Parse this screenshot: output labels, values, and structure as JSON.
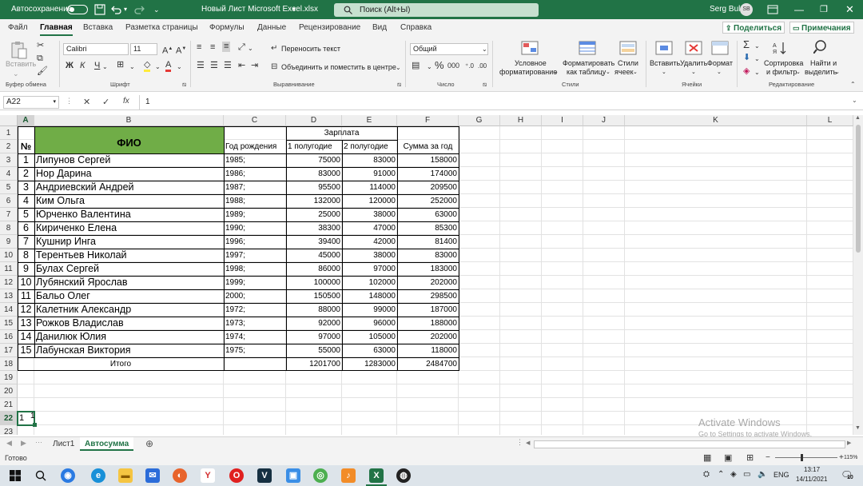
{
  "titlebar": {
    "autosave_label": "Автосохранение",
    "autosave_state": "off",
    "file_name": "Новый Лист Microsoft Excel.xlsx",
    "search_placeholder": "Поиск (Alt+Ы)",
    "user_name": "Serg Bul",
    "user_initials": "SB"
  },
  "menu": {
    "tabs": [
      "Файл",
      "Главная",
      "Вставка",
      "Разметка страницы",
      "Формулы",
      "Данные",
      "Рецензирование",
      "Вид",
      "Справка"
    ],
    "active_tab": "Главная",
    "share_label": "Поделиться",
    "comments_label": "Примечания"
  },
  "ribbon": {
    "paste_label": "Вставить",
    "clipboard_group": "Буфер обмена",
    "font_name": "Calibri",
    "font_size": "11",
    "bold": "Ж",
    "italic": "К",
    "underline": "Ч",
    "font_group": "Шрифт",
    "wrap_text": "Переносить текст",
    "merge_center": "Объединить и поместить в центре",
    "alignment_group": "Выравнивание",
    "number_format": "Общий",
    "number_group": "Число",
    "cond_format_1": "Условное",
    "cond_format_2": "форматирование",
    "format_table_1": "Форматировать",
    "format_table_2": "как таблицу",
    "cell_styles_1": "Стили",
    "cell_styles_2": "ячеек",
    "styles_group": "Стили",
    "insert_label": "Вставить",
    "delete_label": "Удалить",
    "format_label": "Формат",
    "cells_group": "Ячейки",
    "sort_1": "Сортировка",
    "sort_2": "и фильтр",
    "find_1": "Найти и",
    "find_2": "выделить",
    "editing_group": "Редактирование"
  },
  "formula_bar": {
    "name_box": "A22",
    "fx": "fx",
    "formula": "1"
  },
  "columns": [
    "A",
    "B",
    "C",
    "D",
    "E",
    "F",
    "G",
    "H",
    "I",
    "J",
    "K",
    "L"
  ],
  "rows": [
    "1",
    "2",
    "3",
    "4",
    "5",
    "6",
    "7",
    "8",
    "9",
    "10",
    "11",
    "12",
    "13",
    "14",
    "15",
    "16",
    "17",
    "18",
    "19",
    "20",
    "21",
    "22",
    "23",
    "24"
  ],
  "table": {
    "header_num": "№",
    "header_name": "ФИО",
    "header_year": "Год рождения",
    "header_salary": "Зарплата",
    "header_h1": "1 полугодие",
    "header_h2": "2 полугодие",
    "header_sum": "Сумма за год",
    "rows": [
      {
        "n": "1",
        "name": "Липунов Сергей",
        "year": "1985;",
        "h1": "75000",
        "h2": "83000",
        "sum": "158000"
      },
      {
        "n": "2",
        "name": "Нор Дарина",
        "year": "1986;",
        "h1": "83000",
        "h2": "91000",
        "sum": "174000"
      },
      {
        "n": "3",
        "name": "Андриевский Андрей",
        "year": "1987;",
        "h1": "95500",
        "h2": "114000",
        "sum": "209500"
      },
      {
        "n": "4",
        "name": "Ким Ольга",
        "year": "1988;",
        "h1": "132000",
        "h2": "120000",
        "sum": "252000"
      },
      {
        "n": "5",
        "name": "Юрченко Валентина",
        "year": "1989;",
        "h1": "25000",
        "h2": "38000",
        "sum": "63000"
      },
      {
        "n": "6",
        "name": "Кириченко Елена",
        "year": "1990;",
        "h1": "38300",
        "h2": "47000",
        "sum": "85300"
      },
      {
        "n": "7",
        "name": "Кушнир Инга",
        "year": "1996;",
        "h1": "39400",
        "h2": "42000",
        "sum": "81400"
      },
      {
        "n": "8",
        "name": "Терентьев Николай",
        "year": "1997;",
        "h1": "45000",
        "h2": "38000",
        "sum": "83000"
      },
      {
        "n": "9",
        "name": "Булах Сергей",
        "year": "1998;",
        "h1": "86000",
        "h2": "97000",
        "sum": "183000"
      },
      {
        "n": "10",
        "name": "Лубянский Ярослав",
        "year": "1999;",
        "h1": "100000",
        "h2": "102000",
        "sum": "202000"
      },
      {
        "n": "11",
        "name": "Бальо Олег",
        "year": "2000;",
        "h1": "150500",
        "h2": "148000",
        "sum": "298500"
      },
      {
        "n": "12",
        "name": "Калетник Александр",
        "year": "1972;",
        "h1": "88000",
        "h2": "99000",
        "sum": "187000"
      },
      {
        "n": "13",
        "name": "Рожков Владислав",
        "year": "1973;",
        "h1": "92000",
        "h2": "96000",
        "sum": "188000"
      },
      {
        "n": "14",
        "name": "Данилюк Юлия",
        "year": "1974;",
        "h1": "97000",
        "h2": "105000",
        "sum": "202000"
      },
      {
        "n": "15",
        "name": "Лабунская Виктория",
        "year": "1975;",
        "h1": "55000",
        "h2": "63000",
        "sum": "118000"
      }
    ],
    "total_label": "Итого",
    "total_h1": "1201700",
    "total_h2": "1283000",
    "total_sum": "2484700",
    "a22_value": "1",
    "a22_extra": "1"
  },
  "sheets": {
    "tabs": [
      "Лист1",
      "Автосумма"
    ],
    "active": "Автосумма"
  },
  "status": {
    "ready": "Готово",
    "zoom": "115%"
  },
  "watermark": {
    "line1": "Activate Windows",
    "line2": "Go to Settings to activate Windows."
  },
  "taskbar": {
    "lang": "ENG",
    "time": "13:17",
    "date": "14/11/2021",
    "notifications": "10"
  },
  "colors": {
    "excel_green": "#217346",
    "header_fill": "#70ad47"
  }
}
